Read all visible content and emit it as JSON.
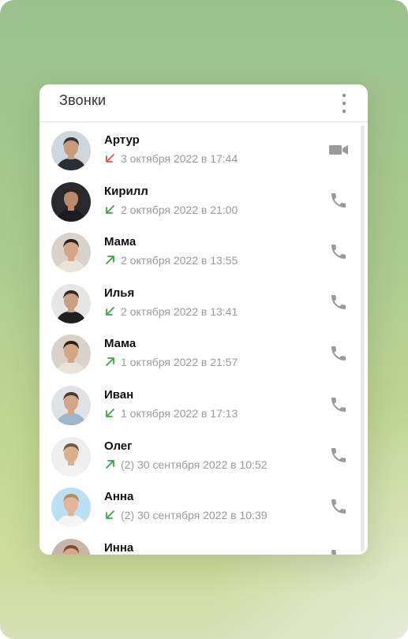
{
  "header": {
    "title": "Звонки",
    "menu_icon": "more-vertical-icon"
  },
  "colors": {
    "incoming": "#3aa63f",
    "outgoing": "#3aa63f",
    "missed": "#e2574c",
    "action_icon": "#9a9a9a"
  },
  "calls": [
    {
      "name": "Артур",
      "direction": "missed",
      "detail": "3 октября 2022 в 17:44",
      "action_icon": "video-camera-icon"
    },
    {
      "name": "Кирилл",
      "direction": "incoming",
      "detail": "2 октября 2022 в 21:00",
      "action_icon": "phone-icon"
    },
    {
      "name": "Мама",
      "direction": "outgoing",
      "detail": "2 октября 2022 в 13:55",
      "action_icon": "phone-icon"
    },
    {
      "name": "Илья",
      "direction": "incoming",
      "detail": "2 октября 2022 в 13:41",
      "action_icon": "phone-icon"
    },
    {
      "name": "Мама",
      "direction": "outgoing",
      "detail": "1 октября 2022 в 21:57",
      "action_icon": "phone-icon"
    },
    {
      "name": "Иван",
      "direction": "incoming",
      "detail": "1 октября 2022 в 17:13",
      "action_icon": "phone-icon"
    },
    {
      "name": "Олег",
      "direction": "outgoing",
      "detail": "(2) 30 сентября 2022 в 10:52",
      "action_icon": "phone-icon"
    },
    {
      "name": "Анна",
      "direction": "incoming",
      "detail": "(2) 30 сентября 2022 в 10:39",
      "action_icon": "phone-icon"
    },
    {
      "name": "Инна",
      "direction": "incoming",
      "detail": "",
      "action_icon": "phone-icon"
    }
  ]
}
